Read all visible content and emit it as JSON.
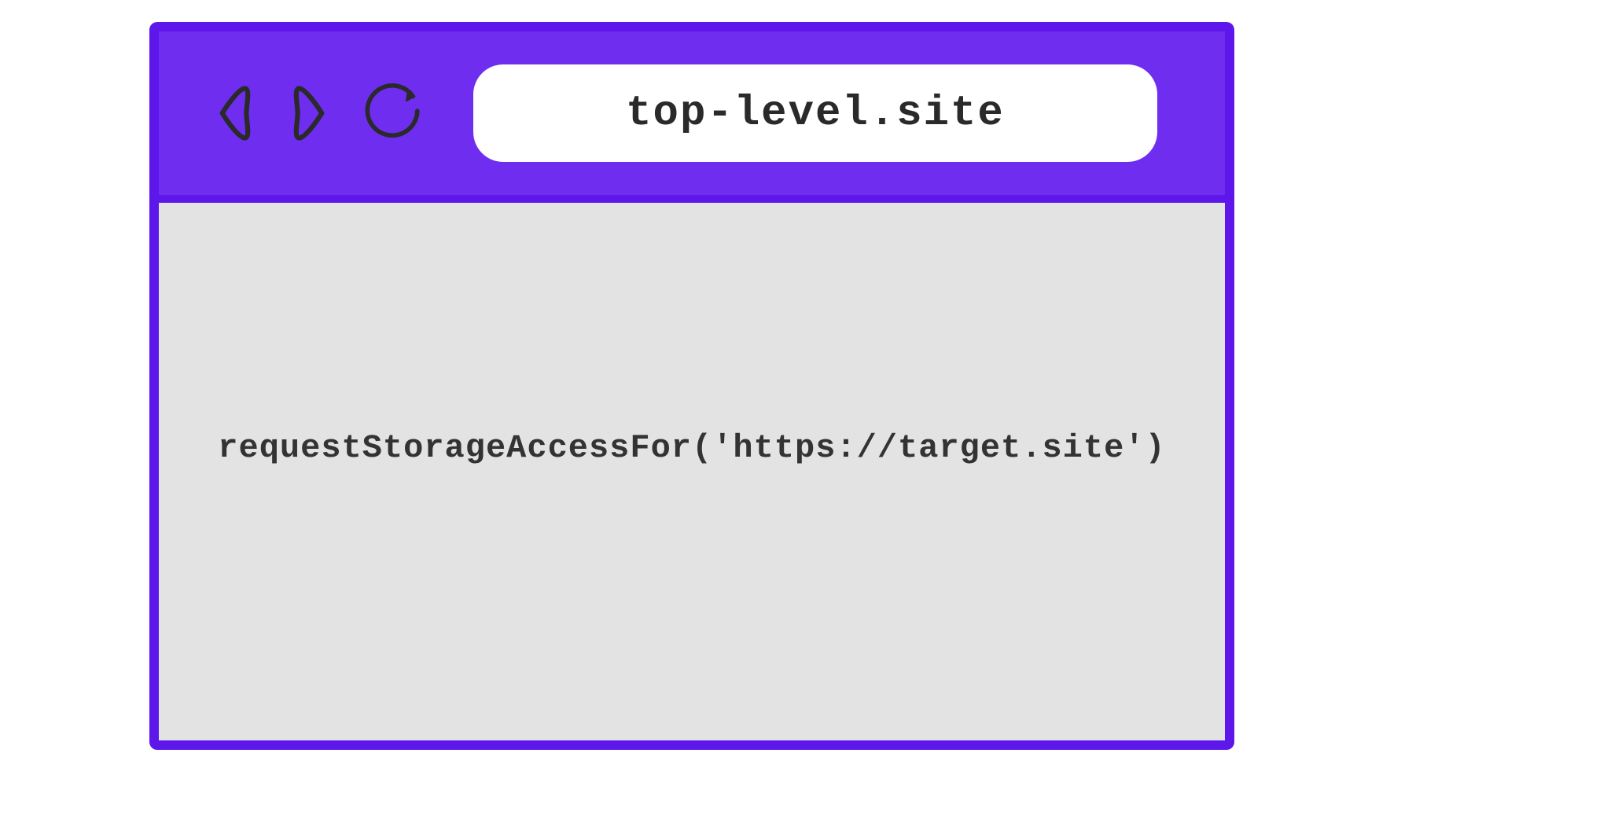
{
  "browser": {
    "url": "top-level.site",
    "viewport_code": "requestStorageAccessFor('https://target.site')"
  },
  "colors": {
    "accent": "#6f2df0",
    "border": "#5e17eb",
    "viewport_bg": "#e3e3e3",
    "addressbar_bg": "#ffffff",
    "text": "#333333"
  }
}
